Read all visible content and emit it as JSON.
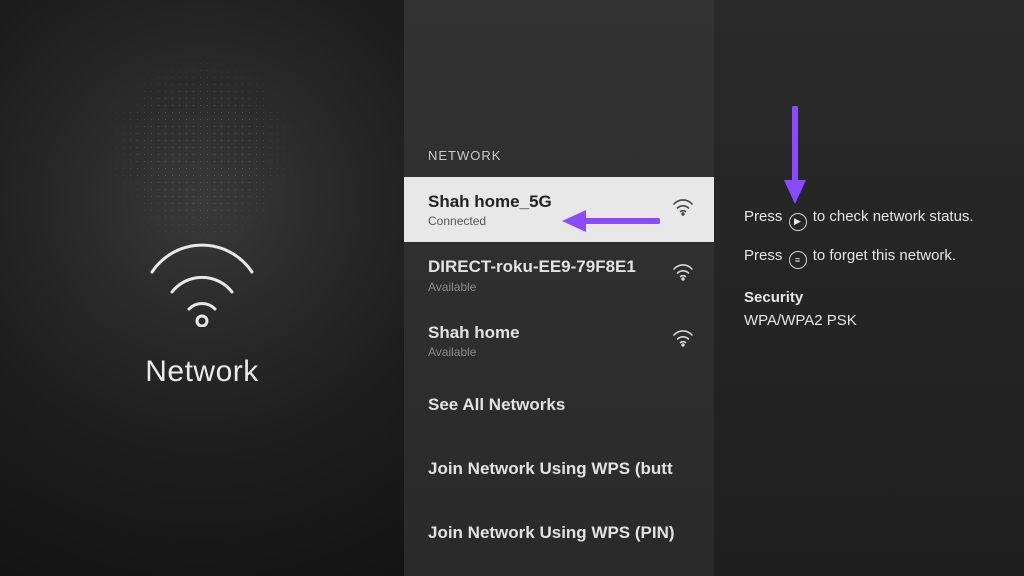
{
  "left": {
    "title": "Network"
  },
  "middle": {
    "header": "NETWORK",
    "networks": [
      {
        "name": "Shah home_5G",
        "status": "Connected",
        "selected": true
      },
      {
        "name": "DIRECT-roku-EE9-79F8E1",
        "status": "Available",
        "selected": false
      },
      {
        "name": "Shah home",
        "status": "Available",
        "selected": false
      }
    ],
    "actions": [
      "See All Networks",
      "Join Network Using WPS (butt",
      "Join Network Using WPS (PIN)"
    ]
  },
  "right": {
    "hint1_pre": "Press",
    "hint1_post": "to check network status.",
    "hint2_pre": "Press",
    "hint2_post": "to forget this network.",
    "security_label": "Security",
    "security_value": "WPA/WPA2 PSK"
  },
  "icons": {
    "play": "▶",
    "menu": "≡"
  },
  "colors": {
    "accent_arrow": "#8a4bff"
  }
}
